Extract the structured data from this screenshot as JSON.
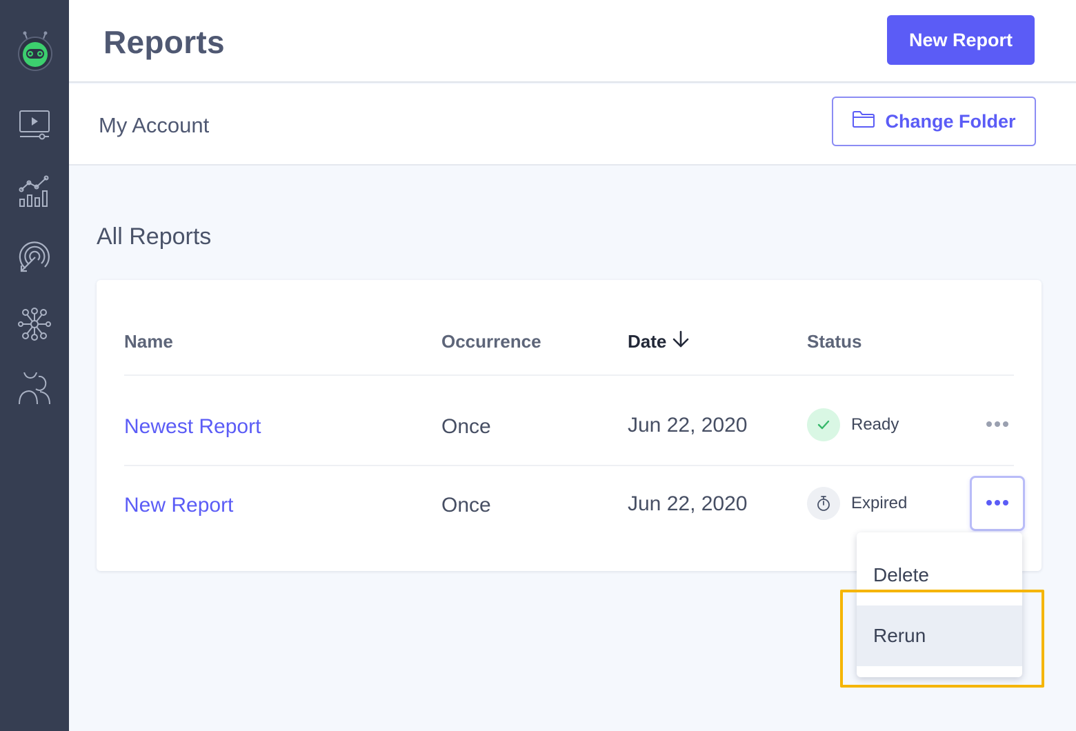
{
  "header": {
    "title": "Reports",
    "new_report_label": "New Report"
  },
  "subheader": {
    "account": "My Account",
    "change_folder_label": "Change Folder"
  },
  "section": {
    "title": "All Reports"
  },
  "table": {
    "columns": {
      "name": "Name",
      "occurrence": "Occurrence",
      "date": "Date",
      "status": "Status"
    },
    "sort": {
      "column": "date",
      "direction": "descending"
    },
    "rows": [
      {
        "name": "Newest Report",
        "occurrence": "Once",
        "date": "Jun 22, 2020",
        "status": "Ready"
      },
      {
        "name": "New Report",
        "occurrence": "Once",
        "date": "Jun 22, 2020",
        "status": "Expired"
      }
    ]
  },
  "menu": {
    "items": [
      "Delete",
      "Rerun"
    ],
    "hovered": "Rerun"
  },
  "sidebar": {
    "icons": [
      "logo-robot-icon",
      "video-icon",
      "analytics-icon",
      "target-icon",
      "network-icon",
      "users-icon"
    ]
  },
  "colors": {
    "sidebar": "#363e52",
    "accent": "#5b5cf6",
    "ready_bg": "#d9f7e4",
    "ready_check": "#37b86a",
    "highlight": "#f5b500"
  }
}
